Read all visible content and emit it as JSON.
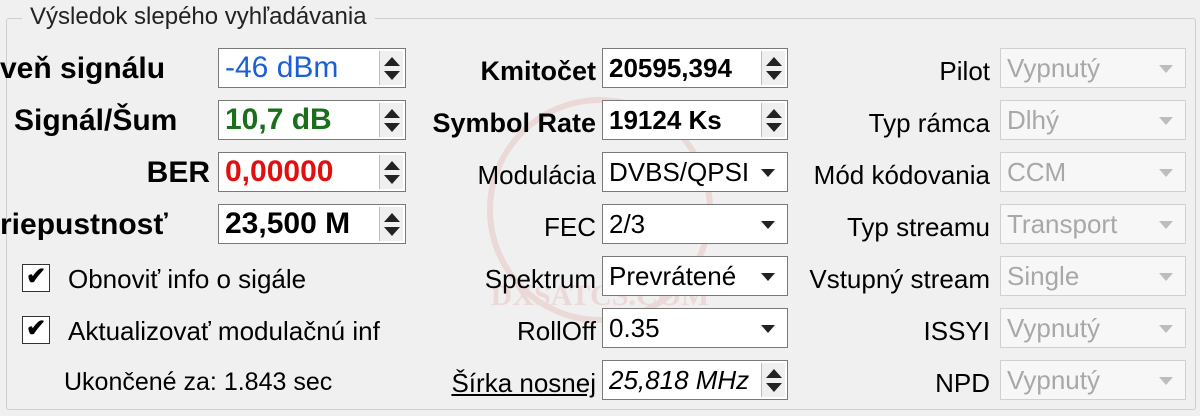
{
  "group_title": "Výsledok slepého vyhľadávania",
  "left": {
    "signal_level": {
      "label": "veň signálu",
      "value": "-46 dBm",
      "color": "#1a5fd6"
    },
    "snr": {
      "label": "Signál/Šum",
      "value": "10,7 dB",
      "color": "#1b6e1b"
    },
    "ber": {
      "label": "BER",
      "value": "0,00000",
      "color": "#e01010"
    },
    "throughput": {
      "label": "riepustnosť",
      "value": "23,500 M"
    },
    "refresh_signal_info": {
      "label": "Obnoviť info o sigále",
      "checked": true
    },
    "update_modulation_info": {
      "label": "Aktualizovať modulačnú inf",
      "checked": true
    },
    "finished_in": "Ukončené za: 1.843 sec"
  },
  "middle": {
    "frequency": {
      "label": "Kmitočet",
      "value": "20595,394"
    },
    "symbol_rate": {
      "label": "Symbol Rate",
      "value": "19124 Ks"
    },
    "modulation": {
      "label": "Modulácia",
      "value": "DVBS/QPSI"
    },
    "fec": {
      "label": "FEC",
      "value": "2/3"
    },
    "spectrum": {
      "label": "Spektrum",
      "value": "Prevrátené"
    },
    "rolloff": {
      "label": "RollOff",
      "value": "0.35"
    },
    "carrier_width": {
      "label": "Šírka nosnej",
      "value": "25,818 MHz"
    }
  },
  "right": {
    "pilot": {
      "label": "Pilot",
      "value": "Vypnutý"
    },
    "frame_type": {
      "label": "Typ rámca",
      "value": "Dlhý"
    },
    "coding_mode": {
      "label": "Mód kódovania",
      "value": "CCM"
    },
    "stream_type": {
      "label": "Typ streamu",
      "value": "Transport"
    },
    "input_stream": {
      "label": "Vstupný stream",
      "value": "Single"
    },
    "issyi": {
      "label": "ISSYI",
      "value": "Vypnutý"
    },
    "npd": {
      "label": "NPD",
      "value": "Vypnutý"
    }
  },
  "watermark": "DXSATCS.COM"
}
